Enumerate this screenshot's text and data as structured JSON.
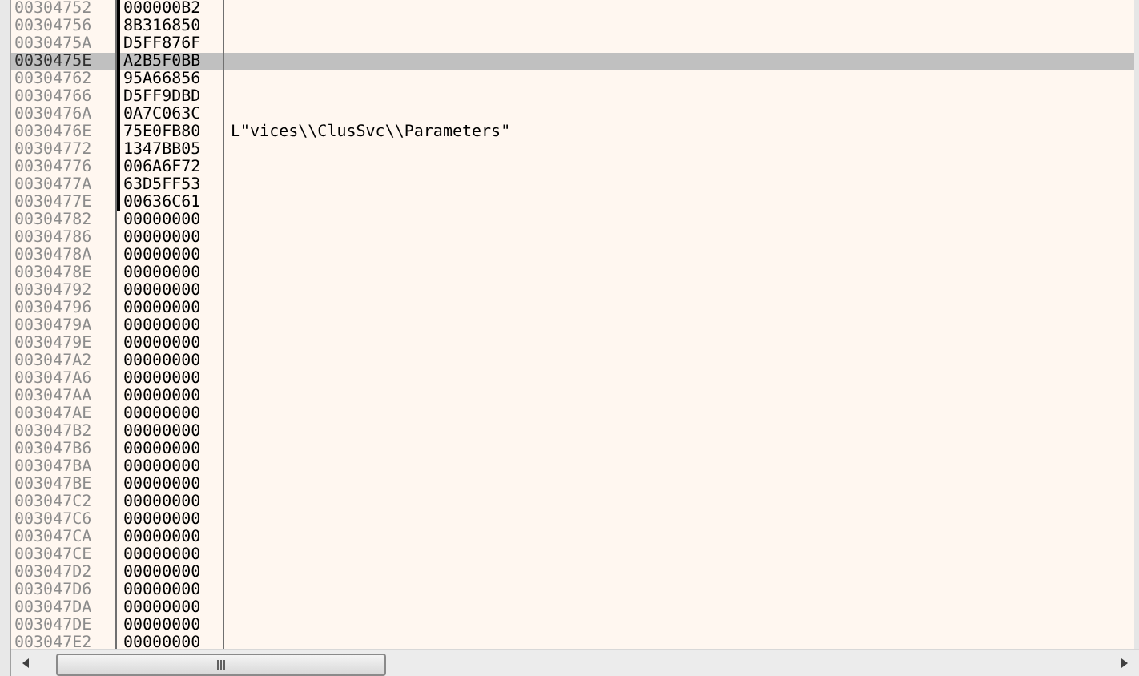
{
  "rows": [
    {
      "address": "00304752",
      "value": "000000B2",
      "selected": false,
      "in_frame": true
    },
    {
      "address": "00304756",
      "value": "8B316850",
      "selected": false,
      "in_frame": true
    },
    {
      "address": "0030475A",
      "value": "D5FF876F",
      "selected": false,
      "in_frame": true
    },
    {
      "address": "0030475E",
      "value": "A2B5F0BB",
      "selected": true,
      "in_frame": true
    },
    {
      "address": "00304762",
      "value": "95A66856",
      "selected": false,
      "in_frame": true
    },
    {
      "address": "00304766",
      "value": "D5FF9DBD",
      "selected": false,
      "in_frame": true
    },
    {
      "address": "0030476A",
      "value": "0A7C063C",
      "selected": false,
      "in_frame": true
    },
    {
      "address": "0030476E",
      "value": "75E0FB80",
      "comment": "L\"vices\\\\ClusSvc\\\\Parameters\"",
      "selected": false,
      "in_frame": true
    },
    {
      "address": "00304772",
      "value": "1347BB05",
      "selected": false,
      "in_frame": true
    },
    {
      "address": "00304776",
      "value": "006A6F72",
      "selected": false,
      "in_frame": true
    },
    {
      "address": "0030477A",
      "value": "63D5FF53",
      "selected": false,
      "in_frame": true
    },
    {
      "address": "0030477E",
      "value": "00636C61",
      "selected": false,
      "in_frame": true
    },
    {
      "address": "00304782",
      "value": "00000000",
      "selected": false,
      "in_frame": false
    },
    {
      "address": "00304786",
      "value": "00000000",
      "selected": false,
      "in_frame": false
    },
    {
      "address": "0030478A",
      "value": "00000000",
      "selected": false,
      "in_frame": false
    },
    {
      "address": "0030478E",
      "value": "00000000",
      "selected": false,
      "in_frame": false
    },
    {
      "address": "00304792",
      "value": "00000000",
      "selected": false,
      "in_frame": false
    },
    {
      "address": "00304796",
      "value": "00000000",
      "selected": false,
      "in_frame": false
    },
    {
      "address": "0030479A",
      "value": "00000000",
      "selected": false,
      "in_frame": false
    },
    {
      "address": "0030479E",
      "value": "00000000",
      "selected": false,
      "in_frame": false
    },
    {
      "address": "003047A2",
      "value": "00000000",
      "selected": false,
      "in_frame": false
    },
    {
      "address": "003047A6",
      "value": "00000000",
      "selected": false,
      "in_frame": false
    },
    {
      "address": "003047AA",
      "value": "00000000",
      "selected": false,
      "in_frame": false
    },
    {
      "address": "003047AE",
      "value": "00000000",
      "selected": false,
      "in_frame": false
    },
    {
      "address": "003047B2",
      "value": "00000000",
      "selected": false,
      "in_frame": false
    },
    {
      "address": "003047B6",
      "value": "00000000",
      "selected": false,
      "in_frame": false
    },
    {
      "address": "003047BA",
      "value": "00000000",
      "selected": false,
      "in_frame": false
    },
    {
      "address": "003047BE",
      "value": "00000000",
      "selected": false,
      "in_frame": false
    },
    {
      "address": "003047C2",
      "value": "00000000",
      "selected": false,
      "in_frame": false
    },
    {
      "address": "003047C6",
      "value": "00000000",
      "selected": false,
      "in_frame": false
    },
    {
      "address": "003047CA",
      "value": "00000000",
      "selected": false,
      "in_frame": false
    },
    {
      "address": "003047CE",
      "value": "00000000",
      "selected": false,
      "in_frame": false
    },
    {
      "address": "003047D2",
      "value": "00000000",
      "selected": false,
      "in_frame": false
    },
    {
      "address": "003047D6",
      "value": "00000000",
      "selected": false,
      "in_frame": false
    },
    {
      "address": "003047DA",
      "value": "00000000",
      "selected": false,
      "in_frame": false
    },
    {
      "address": "003047DE",
      "value": "00000000",
      "selected": false,
      "in_frame": false
    },
    {
      "address": "003047E2",
      "value": "00000000",
      "selected": false,
      "in_frame": false
    }
  ]
}
